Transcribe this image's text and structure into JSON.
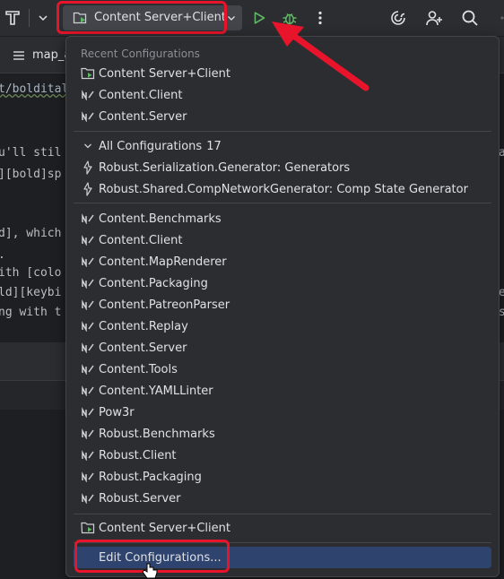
{
  "toolbar": {
    "run_config_label": "Content Server+Client",
    "icons": [
      "project-logo-icon",
      "chevron-down-icon",
      "run-icon",
      "debug-icon",
      "more-icon",
      "ai-assistant-icon",
      "add-user-icon",
      "search-icon",
      "settings-gear-icon"
    ]
  },
  "tab": {
    "label": "map_a"
  },
  "editor": {
    "lines": [
      "t/bolditalic",
      "u'll stil",
      "][bold]sp",
      "d], which",
      ".",
      "ith [colo",
      "ld][keybi",
      "ng with t"
    ],
    "right_fragments": [
      "a",
      "e",
      "s"
    ]
  },
  "popup": {
    "recent_header": "Recent Configurations",
    "recent": [
      {
        "label": "Content Server+Client",
        "icon": "compound-config-icon"
      },
      {
        "label": "Content.Client",
        "icon": "dotnet-config-icon"
      },
      {
        "label": "Content.Server",
        "icon": "dotnet-config-icon"
      }
    ],
    "all_header": "All Configurations",
    "all_count": "17",
    "generators": [
      {
        "label": "Robust.Serialization.Generator: Generators",
        "icon": "generator-icon"
      },
      {
        "label": "Robust.Shared.CompNetworkGenerator: Comp State Generator",
        "icon": "generator-icon"
      }
    ],
    "configs": [
      "Content.Benchmarks",
      "Content.Client",
      "Content.MapRenderer",
      "Content.Packaging",
      "Content.PatreonParser",
      "Content.Replay",
      "Content.Server",
      "Content.Tools",
      "Content.YAMLLinter",
      "Pow3r",
      "Robust.Benchmarks",
      "Robust.Client",
      "Robust.Packaging",
      "Robust.Server"
    ],
    "compound": {
      "label": "Content Server+Client",
      "icon": "compound-config-icon"
    },
    "edit": "Edit Configurations..."
  },
  "colors": {
    "highlight": "#e8142b",
    "selection": "#2e436e",
    "run_green": "#5fb865"
  }
}
